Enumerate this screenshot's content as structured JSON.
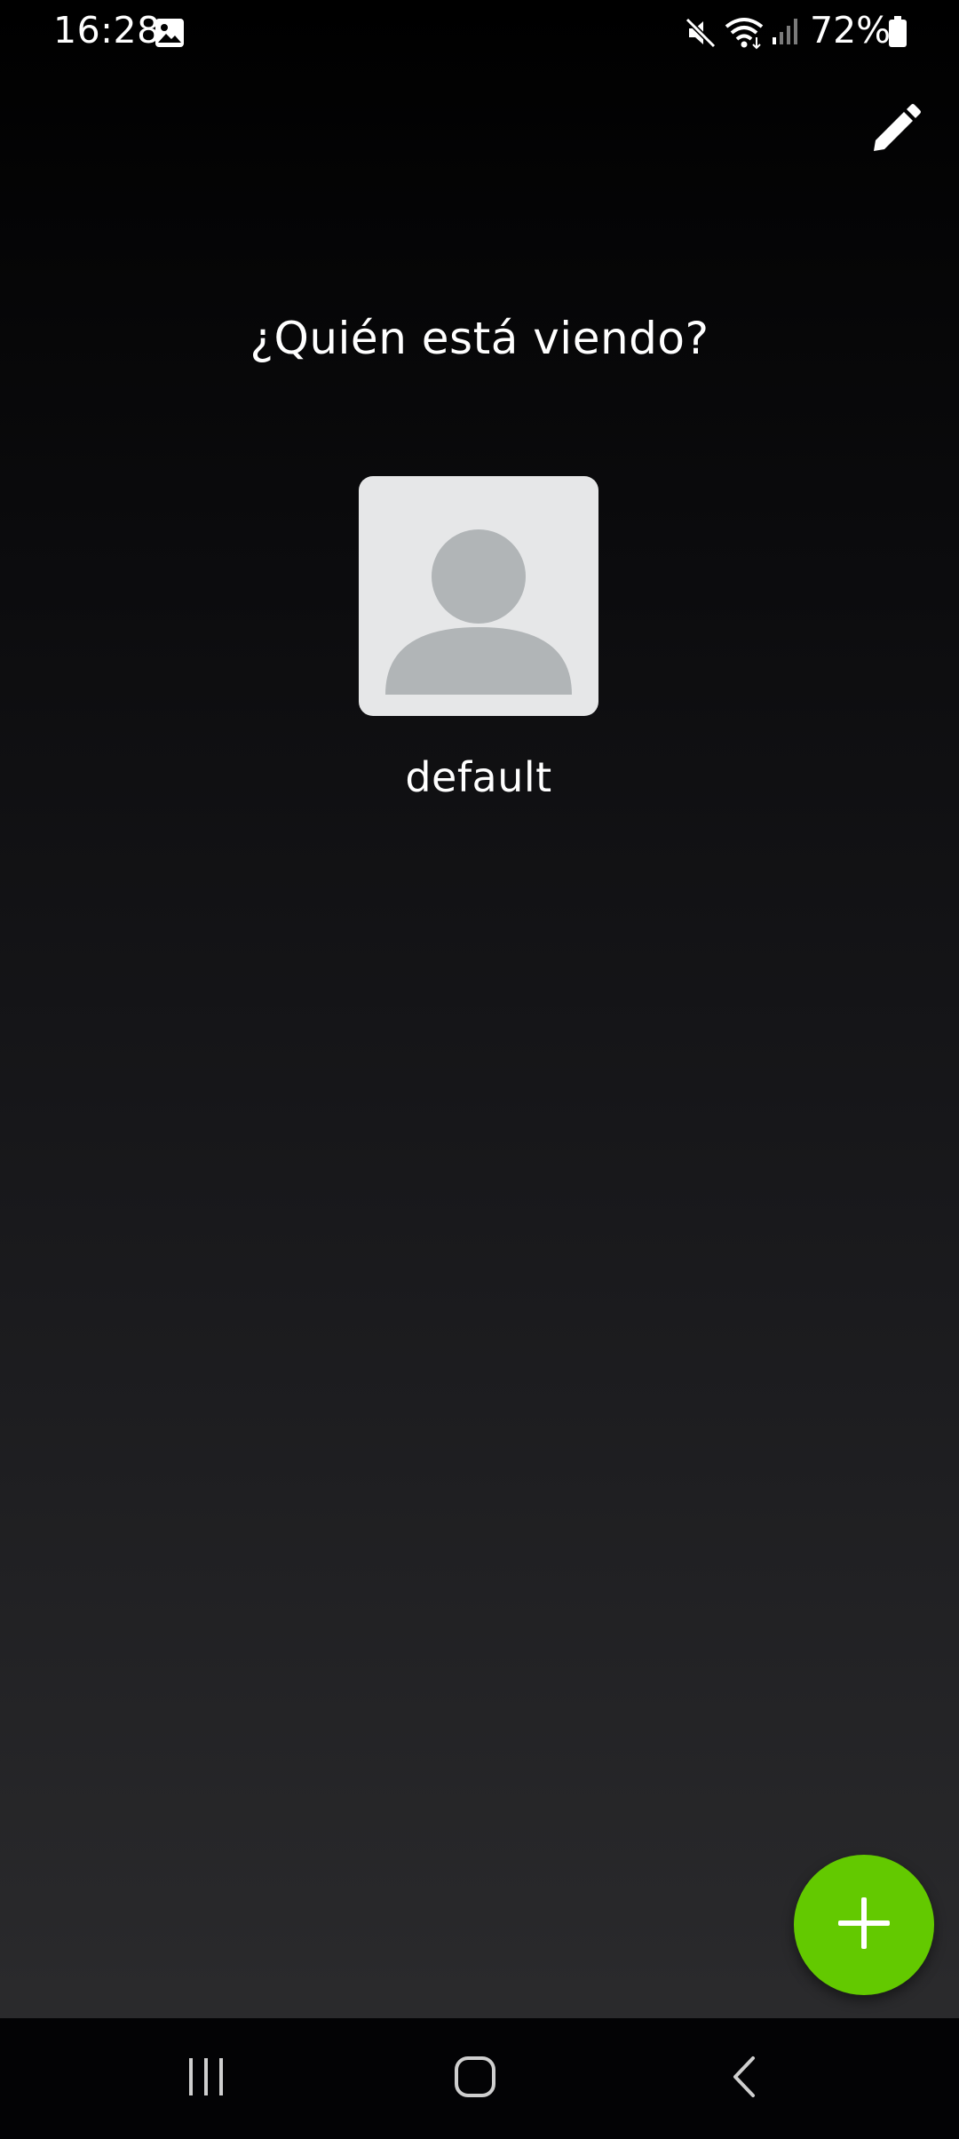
{
  "status_bar": {
    "time": "16:28",
    "battery_percent": "72%",
    "battery_level": 0.72,
    "icons": [
      "gallery-icon",
      "mute-icon",
      "wifi-icon",
      "signal-icon",
      "battery-icon"
    ]
  },
  "header": {
    "edit_icon": "pencil-icon"
  },
  "main": {
    "title": "¿Quién está viendo?",
    "profiles": [
      {
        "name": "default",
        "avatar": "default-person-avatar"
      }
    ]
  },
  "fab": {
    "icon": "plus-icon",
    "color": "#63c900"
  },
  "nav_bar": {
    "buttons": [
      "recent-apps-icon",
      "home-icon",
      "back-icon"
    ]
  },
  "colors": {
    "accent": "#63c900",
    "avatar_bg": "#e6e7e8",
    "avatar_figure": "#b1b5b7"
  }
}
